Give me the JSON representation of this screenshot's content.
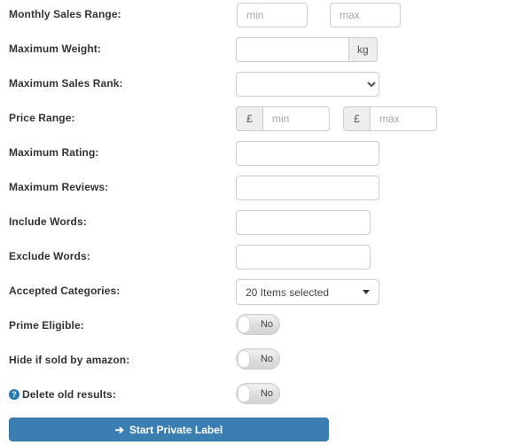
{
  "form": {
    "rows": [
      {
        "label": "Monthly Sales Range:",
        "type": "range",
        "min_placeholder": "min",
        "max_placeholder": "max",
        "min_value": "",
        "max_value": ""
      },
      {
        "label": "Maximum Weight:",
        "type": "unit",
        "value": "",
        "unit": "kg"
      },
      {
        "label": "Maximum Sales Rank:",
        "type": "select",
        "selected": "",
        "options": [
          ""
        ]
      },
      {
        "label": "Price Range:",
        "type": "currency-range",
        "currency": "£",
        "min_placeholder": "min",
        "max_placeholder": "max",
        "min_value": "",
        "max_value": ""
      },
      {
        "label": "Maximum Rating:",
        "type": "text",
        "value": ""
      },
      {
        "label": "Maximum Reviews:",
        "type": "text",
        "value": ""
      },
      {
        "label": "Include Words:",
        "type": "text",
        "value": ""
      },
      {
        "label": "Exclude Words:",
        "type": "text",
        "value": ""
      },
      {
        "label": "Accepted Categories:",
        "type": "multiselect",
        "selected_text": "20 Items selected"
      },
      {
        "label": "Prime Eligible:",
        "type": "toggle",
        "state": "No"
      },
      {
        "label": "Hide if sold by amazon:",
        "type": "toggle",
        "state": "No"
      },
      {
        "label": "Delete old results:",
        "type": "toggle",
        "state": "No",
        "help_icon": "?"
      }
    ],
    "submit": {
      "label": "Start Private Label",
      "icon": "➔",
      "color": "#3b7eb1"
    }
  }
}
